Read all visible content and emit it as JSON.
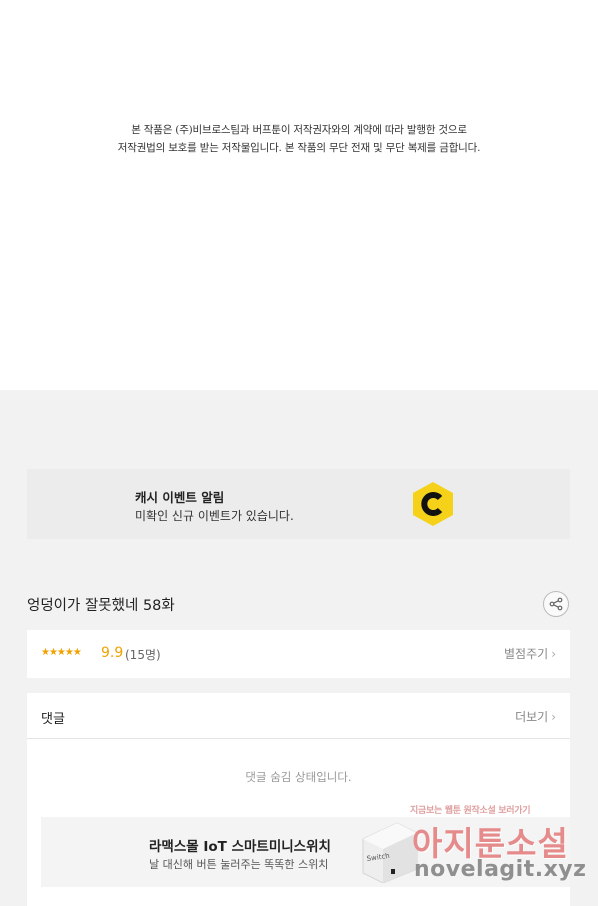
{
  "copyright": {
    "line1": "본 작품은 (주)비브로스팀과 버프툰이 저작권자와의 계약에 따라 발행한 것으로",
    "line2": "저작권법의 보호를 받는 저작물입니다. 본 작품의 무단 전재 및 무단 복제를 금합니다."
  },
  "cash_banner": {
    "title": "캐시 이벤트 알림",
    "subtitle": "미확인 신규 이벤트가 있습니다.",
    "logo_icon": "cash-c-logo-icon",
    "logo_color": "#f5d11a"
  },
  "episode": {
    "title": "엉덩이가 잘못했네 58화",
    "share_icon": "share-icon"
  },
  "rating": {
    "stars": "★★★★★",
    "score": "9.9",
    "count": "(15명)",
    "rate_link": "별점주기",
    "accent_color": "#f0a200"
  },
  "comments": {
    "title": "댓글",
    "more_link": "더보기",
    "hidden_message": "댓글 숨김 상태입니다."
  },
  "ad": {
    "title": "라맥스몰 IoT 스마트미니스위치",
    "subtitle": "날 대신해 버튼 눌러주는 똑똑한 스위치",
    "product_label": "Switch"
  },
  "watermark": {
    "top": "지금보는 웹툰 원작소설 보러가기",
    "main": "아지툰소설",
    "url": "novelagit.xyz"
  }
}
